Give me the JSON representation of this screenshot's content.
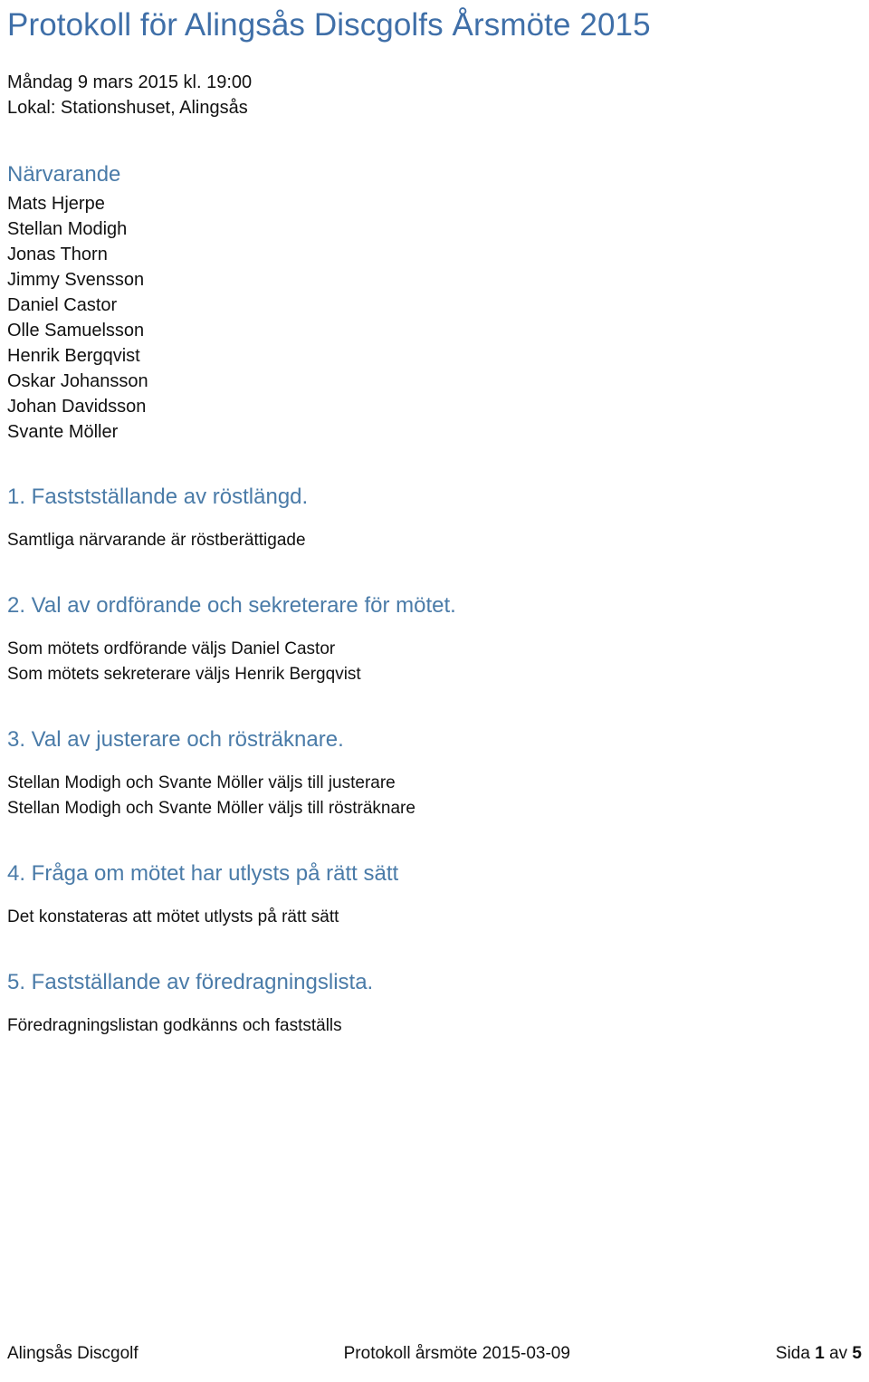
{
  "document": {
    "title": "Protokoll för Alingsås Discgolfs Årsmöte 2015",
    "meta": {
      "datetime": "Måndag 9 mars 2015 kl. 19:00",
      "location": "Lokal: Stationshuset, Alingsås"
    },
    "attendees": {
      "heading": "Närvarande",
      "names": [
        "Mats Hjerpe",
        "Stellan Modigh",
        "Jonas Thorn",
        "Jimmy Svensson",
        "Daniel Castor",
        "Olle Samuelsson",
        "Henrik Bergqvist",
        "Oskar Johansson",
        "Johan Davidsson",
        "Svante Möller"
      ]
    },
    "sections": [
      {
        "heading": "1. Faststställande av röstlängd.",
        "lines": [
          "Samtliga närvarande är röstberättigade"
        ]
      },
      {
        "heading": "2. Val av ordförande och sekreterare för mötet.",
        "lines": [
          "Som mötets ordförande väljs Daniel Castor",
          "Som mötets sekreterare väljs Henrik Bergqvist"
        ]
      },
      {
        "heading": "3. Val av justerare och rösträknare.",
        "lines": [
          "Stellan Modigh och Svante Möller väljs till justerare",
          "Stellan Modigh och Svante Möller väljs till rösträknare"
        ]
      },
      {
        "heading": "4. Fråga om mötet har utlysts på rätt sätt",
        "lines": [
          "Det konstateras att mötet utlysts på rätt sätt"
        ]
      },
      {
        "heading": "5. Fastställande av föredragningslista.",
        "lines": [
          "Föredragningslistan godkänns och fastställs"
        ]
      }
    ],
    "footer": {
      "left": "Alingsås Discgolf",
      "center": "Protokoll årsmöte 2015-03-09",
      "right_prefix": "Sida ",
      "right_page": "1",
      "right_middle": " av ",
      "right_total": "5"
    }
  },
  "colors": {
    "heading_blue": "#4a7ba8",
    "title_blue": "#3f6fa8",
    "body_text": "#111111",
    "page_background": "#ffffff"
  }
}
